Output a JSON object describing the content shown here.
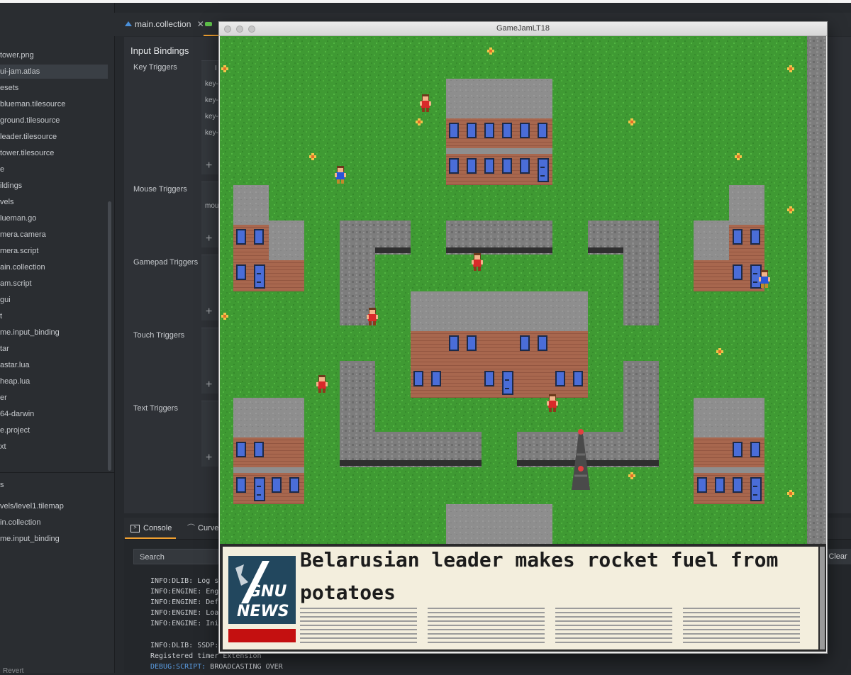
{
  "sidebar": {
    "items": [
      {
        "label": "tower.png"
      },
      {
        "label": "ui-jam.atlas"
      },
      {
        "label": "esets"
      },
      {
        "label": "blueman.tilesource"
      },
      {
        "label": "ground.tilesource"
      },
      {
        "label": "leader.tilesource"
      },
      {
        "label": "tower.tilesource"
      },
      {
        "label": "e"
      },
      {
        "label": "ildings"
      },
      {
        "label": "vels"
      },
      {
        "label": "lueman.go"
      },
      {
        "label": "mera.camera"
      },
      {
        "label": "mera.script"
      },
      {
        "label": "ain.collection"
      },
      {
        "label": "am.script"
      },
      {
        "label": "gui"
      },
      {
        "label": "t"
      },
      {
        "label": "me.input_binding"
      },
      {
        "label": "tar"
      },
      {
        "label": "astar.lua"
      },
      {
        "label": "heap.lua"
      },
      {
        "label": "er"
      },
      {
        "label": "64-darwin"
      },
      {
        "label": "e.project"
      },
      {
        "label": "xt"
      }
    ],
    "open_section_label": "s",
    "open_items": [
      {
        "label": "vels/level1.tilemap"
      },
      {
        "label": "in.collection"
      },
      {
        "label": "me.input_binding"
      }
    ],
    "revert_label": "Revert"
  },
  "tabs": [
    {
      "label": "main.collection",
      "close": "✕"
    }
  ],
  "editor": {
    "title": "Input Bindings",
    "sections": [
      {
        "label": "Key Triggers"
      },
      {
        "label": "Mouse Triggers"
      },
      {
        "label": "Gamepad Triggers"
      },
      {
        "label": "Touch Triggers"
      },
      {
        "label": "Text Triggers"
      }
    ],
    "key_column_header": "I",
    "key_rows": [
      "key-",
      "key-",
      "key-",
      "key-"
    ],
    "mouse_rows": [
      "mou"
    ],
    "add_symbol": "+"
  },
  "console": {
    "tabs": [
      {
        "label": "Console"
      },
      {
        "label": "Curve"
      }
    ],
    "search_placeholder": "Search",
    "clear_label": "Clear",
    "lines": [
      {
        "text": "INFO:DLIB: Log s"
      },
      {
        "text": "INFO:ENGINE: Eng"
      },
      {
        "text": "INFO:ENGINE: Def"
      },
      {
        "text": "INFO:ENGINE: Loa"
      },
      {
        "text": "INFO:ENGINE: Ini"
      },
      {
        "text": "INFO:DLIB: SSDP:"
      },
      {
        "text": "Registered timer Extension"
      }
    ],
    "debug_prefix": "DEBUG:SCRIPT:",
    "debug_text": " BROADCASTING OVER"
  },
  "game_window": {
    "title": "GameJamLT18",
    "news": {
      "headline_line1": "Belarusian leader makes rocket fuel from",
      "headline_line2": "potatoes",
      "logo_line1": "GNU",
      "logo_line2": "NEWS"
    }
  },
  "colors": {
    "accent": "#f0a030",
    "grass": "#3f9a33",
    "roof": "#8e8e8e",
    "brick": "#a8674e",
    "window": "#4a6dd8",
    "news_paper": "#f3eedd",
    "logo_bg": "#22475e",
    "logo_bar": "#c41010"
  }
}
